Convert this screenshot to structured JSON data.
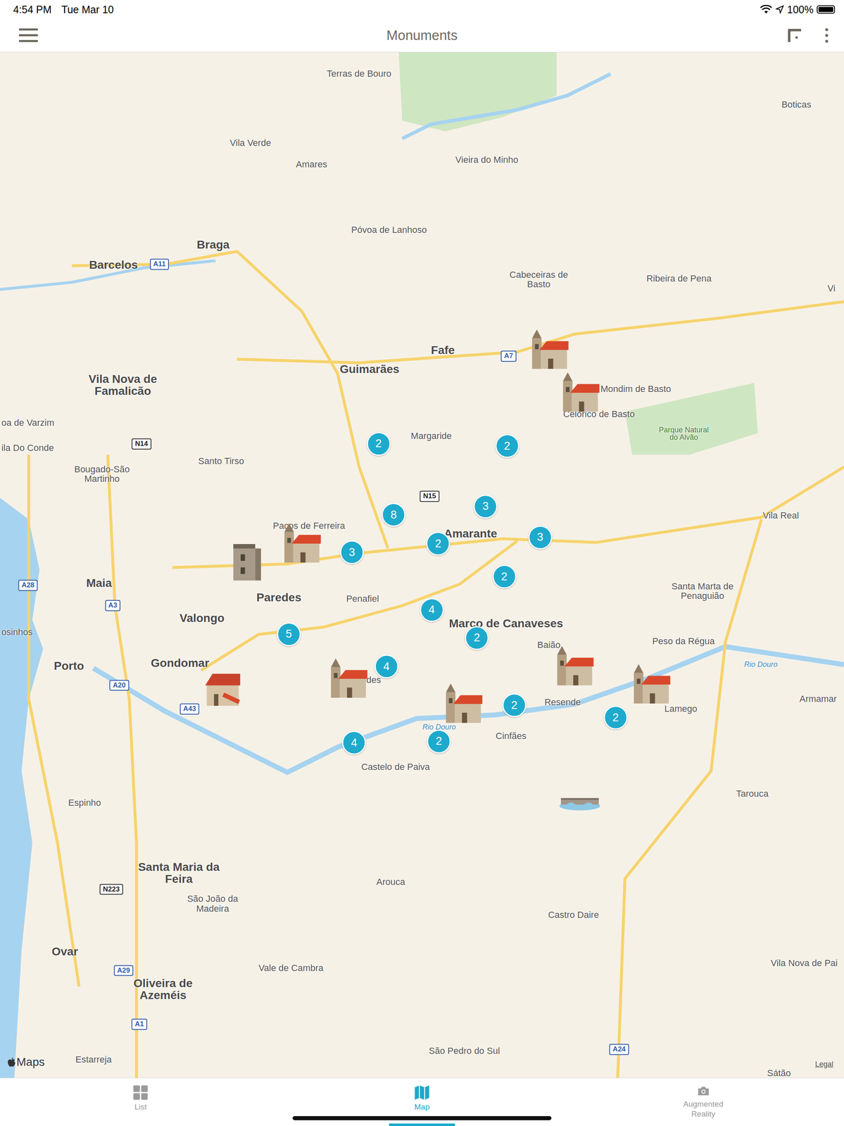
{
  "status_bar": {
    "time": "4:54 PM",
    "date": "Tue Mar 10",
    "battery": "100%",
    "battery_level": 1
  },
  "nav": {
    "title": "Monuments"
  },
  "map": {
    "places": [
      {
        "name": "Terras de Bouro",
        "kind": "town"
      },
      {
        "name": "Vila Verde",
        "kind": "town"
      },
      {
        "name": "Amares",
        "kind": "town"
      },
      {
        "name": "Vieira do Minho",
        "kind": "town"
      },
      {
        "name": "Póvoa de Lanhoso",
        "kind": "town"
      },
      {
        "name": "Braga",
        "kind": "city"
      },
      {
        "name": "Barcelos",
        "kind": "city"
      },
      {
        "name": "Cabeceiras de Basto",
        "kind": "town"
      },
      {
        "name": "Ribeira de Pena",
        "kind": "town"
      },
      {
        "name": "Boticas",
        "kind": "town"
      },
      {
        "name": "Fafe",
        "kind": "city"
      },
      {
        "name": "Guimarães",
        "kind": "city"
      },
      {
        "name": "Vila Nova de Famalicão",
        "kind": "city"
      },
      {
        "name": "Mondim de Basto",
        "kind": "town"
      },
      {
        "name": "Celorico de Basto",
        "kind": "town"
      },
      {
        "name": "Parque Natural do Alvão",
        "kind": "park"
      },
      {
        "name": "Margaride",
        "kind": "town"
      },
      {
        "name": "Santo Tirso",
        "kind": "town"
      },
      {
        "name": "Bougado-São Martinho",
        "kind": "town"
      },
      {
        "name": "oa de Varzim",
        "kind": "town"
      },
      {
        "name": "ila Do Conde",
        "kind": "town"
      },
      {
        "name": "Vila Real",
        "kind": "town"
      },
      {
        "name": "Paços de Ferreira",
        "kind": "town"
      },
      {
        "name": "Amarante",
        "kind": "city"
      },
      {
        "name": "Maia",
        "kind": "city"
      },
      {
        "name": "Paredes",
        "kind": "city"
      },
      {
        "name": "Penafiel",
        "kind": "town"
      },
      {
        "name": "Valongo",
        "kind": "city"
      },
      {
        "name": "Santa Marta de Penaguião",
        "kind": "town"
      },
      {
        "name": "Marco de Canaveses",
        "kind": "city"
      },
      {
        "name": "osinhos",
        "kind": "town"
      },
      {
        "name": "Porto",
        "kind": "city"
      },
      {
        "name": "Gondomar",
        "kind": "city"
      },
      {
        "name": "Baião",
        "kind": "town"
      },
      {
        "name": "Peso da Régua",
        "kind": "town"
      },
      {
        "name": "Rio Douro",
        "kind": "water"
      },
      {
        "name": "Armamar",
        "kind": "town"
      },
      {
        "name": "Resende",
        "kind": "town"
      },
      {
        "name": "Lamego",
        "kind": "town"
      },
      {
        "name": "edes",
        "kind": "town"
      },
      {
        "name": "Cinfães",
        "kind": "town"
      },
      {
        "name": "Rio Douro",
        "kind": "water"
      },
      {
        "name": "Castelo de Paiva",
        "kind": "town"
      },
      {
        "name": "Espinho",
        "kind": "town"
      },
      {
        "name": "Tarouca",
        "kind": "town"
      },
      {
        "name": "Santa Maria da Feira",
        "kind": "city"
      },
      {
        "name": "São João da Madeira",
        "kind": "town"
      },
      {
        "name": "Arouca",
        "kind": "town"
      },
      {
        "name": "Castro Daire",
        "kind": "town"
      },
      {
        "name": "Ovar",
        "kind": "city"
      },
      {
        "name": "Vale de Cambra",
        "kind": "town"
      },
      {
        "name": "Vila Nova de Pai",
        "kind": "town"
      },
      {
        "name": "Oliveira de Azeméis",
        "kind": "city"
      },
      {
        "name": "Estarreja",
        "kind": "town"
      },
      {
        "name": "São Pedro do Sul",
        "kind": "town"
      },
      {
        "name": "Sátão",
        "kind": "town"
      },
      {
        "name": "Vi",
        "kind": "town"
      }
    ],
    "roads": [
      {
        "label": "A11",
        "kind": "motorway"
      },
      {
        "label": "A7",
        "kind": "motorway"
      },
      {
        "label": "N14",
        "kind": "national"
      },
      {
        "label": "N15",
        "kind": "national"
      },
      {
        "label": "A28",
        "kind": "motorway"
      },
      {
        "label": "A3",
        "kind": "motorway"
      },
      {
        "label": "A20",
        "kind": "motorway"
      },
      {
        "label": "A43",
        "kind": "motorway"
      },
      {
        "label": "N223",
        "kind": "national"
      },
      {
        "label": "A29",
        "kind": "motorway"
      },
      {
        "label": "A1",
        "kind": "motorway"
      },
      {
        "label": "A24",
        "kind": "motorway"
      }
    ],
    "clusters": [
      {
        "count": "2"
      },
      {
        "count": "2"
      },
      {
        "count": "3"
      },
      {
        "count": "8"
      },
      {
        "count": "3"
      },
      {
        "count": "2"
      },
      {
        "count": "3"
      },
      {
        "count": "2"
      },
      {
        "count": "4"
      },
      {
        "count": "5"
      },
      {
        "count": "2"
      },
      {
        "count": "4"
      },
      {
        "count": "2"
      },
      {
        "count": "2"
      },
      {
        "count": "2"
      },
      {
        "count": "4"
      }
    ],
    "monuments": [
      {
        "kind": "church"
      },
      {
        "kind": "church"
      },
      {
        "kind": "tower"
      },
      {
        "kind": "church"
      },
      {
        "kind": "house"
      },
      {
        "kind": "church"
      },
      {
        "kind": "church"
      },
      {
        "kind": "church"
      },
      {
        "kind": "church"
      },
      {
        "kind": "bridge"
      }
    ],
    "attribution": {
      "logo": "Maps",
      "legal": "Legal"
    }
  },
  "tabs": [
    {
      "label": "List",
      "selected": false
    },
    {
      "label": "Map",
      "selected": true
    },
    {
      "label": "Augmented Reality",
      "selected": false
    }
  ]
}
